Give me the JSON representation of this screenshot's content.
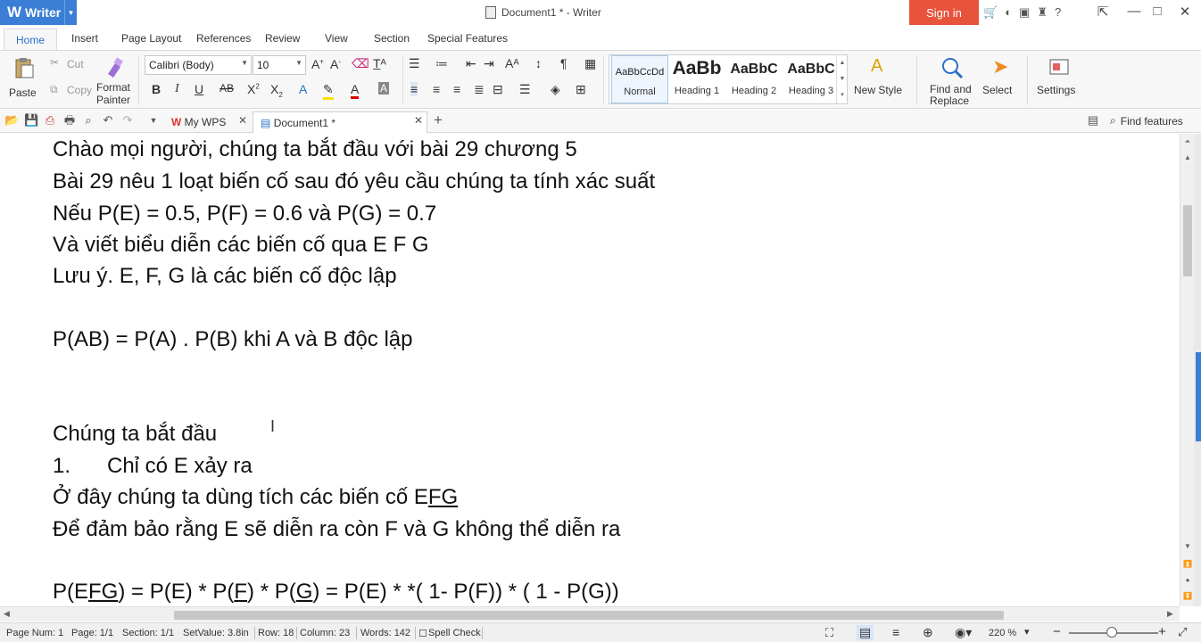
{
  "app": {
    "name": "Writer",
    "logo": "W"
  },
  "window": {
    "title": "Document1 * - Writer",
    "signin": "Sign in"
  },
  "menu": {
    "tabs": [
      "Home",
      "Insert",
      "Page Layout",
      "References",
      "Review",
      "View",
      "Section",
      "Special Features"
    ]
  },
  "ribbon": {
    "paste": "Paste",
    "cut": "Cut",
    "copy": "Copy",
    "format_painter_1": "Format",
    "format_painter_2": "Painter",
    "font_name": "Calibri (Body)",
    "font_size": "10",
    "styles": [
      {
        "preview": "AaBbCcDd",
        "name": "Normal"
      },
      {
        "preview": "AaBb",
        "name": "Heading 1"
      },
      {
        "preview": "AaBbC",
        "name": "Heading 2"
      },
      {
        "preview": "AaBbC",
        "name": "Heading 3"
      }
    ],
    "new_style": "New Style",
    "find_replace_1": "Find and",
    "find_replace_2": "Replace",
    "select": "Select",
    "settings": "Settings"
  },
  "tabs": {
    "my_wps": "My WPS",
    "document": "Document1 *",
    "find_features": "Find features"
  },
  "document": {
    "lines": [
      "Chào mọi người, chúng ta bắt đầu với bài 29 chương 5",
      "Bài 29 nêu 1 loạt biến cố sau đó yêu cầu chúng ta tính xác suất",
      "Nếu P(E) = 0.5, P(F) = 0.6 và P(G) = 0.7",
      "Và viết biểu diễn các biến cố qua E F G",
      "Lưu ý. E, F, G là các biến cố độc lập",
      "P(AB) = P(A) . P(B) khi A và B độc lập",
      "Chúng ta bắt đầu"
    ],
    "list_num": "1.",
    "list_text": "Chỉ có E xảy ra",
    "line_efg_prefix": "Ở đây chúng ta dùng tích các biến cố E",
    "line_efg_underlined": "FG",
    "line_guarantee": "Để đảm bảo rằng E sẽ diễn ra còn F và G không thể diễn ra",
    "formula": {
      "a": "P(E",
      "b": "FG",
      "c": ") = P(E) * P(",
      "d": "F",
      "e": ") * P(",
      "f": "G",
      "g": ") = P(E) * *( 1- P(F)) * ( 1 - P(G))"
    }
  },
  "status": {
    "page_num": "Page Num: 1",
    "page": "Page: 1/1",
    "section": "Section: 1/1",
    "set_value": "SetValue: 3.8in",
    "row": "Row: 18",
    "column": "Column: 23",
    "words": "Words: 142",
    "spell_check": "Spell Check",
    "zoom": "220 %"
  },
  "colors": {
    "accent": "#3a7fd5",
    "signin": "#e8533c"
  }
}
